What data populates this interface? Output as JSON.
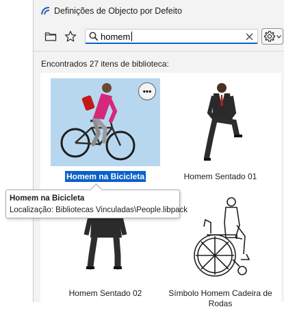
{
  "window": {
    "title": "Definições de Objecto por Defeito"
  },
  "toolbar": {
    "folder_icon": "folder-icon",
    "favorites_icon": "star-icon",
    "settings_icon": "gear-icon"
  },
  "search": {
    "value": "homem",
    "placeholder": ""
  },
  "results": {
    "found_text": "Encontrados 27 itens de biblioteca:"
  },
  "items": [
    {
      "label": "Homem na Bicicleta",
      "selected": true
    },
    {
      "label": "Homem Sentado 01",
      "selected": false
    },
    {
      "label": "Homem Sentado 02",
      "selected": false
    },
    {
      "label": "Símbolo Homem Cadeira de Rodas",
      "selected": false
    }
  ],
  "tooltip": {
    "title": "Homem na Bicicleta",
    "location": "Localização: Bibliotecas Vinculadas\\People.libpack"
  },
  "colors": {
    "accent": "#0a62c8",
    "selection": "#0a62c8",
    "thumb_bg": "#b7d7ef"
  }
}
